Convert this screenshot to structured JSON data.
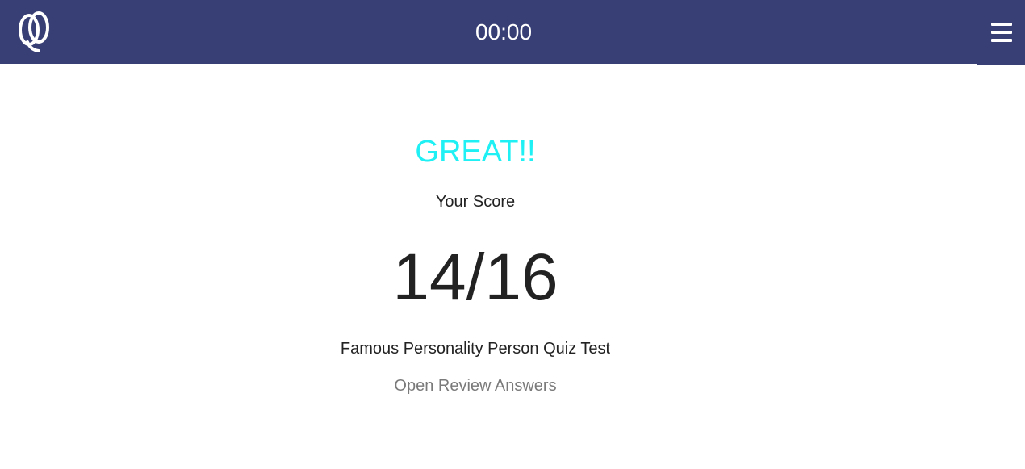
{
  "header": {
    "logo_icon": "quiz-logo-icon",
    "timer": "00:00",
    "menu_icon": "hamburger-menu-icon",
    "background_color": "#383f75"
  },
  "result": {
    "verdict": "GREAT!!",
    "verdict_color": "#1ff0f4",
    "score_label": "Your Score",
    "score": "14/16",
    "quiz_title": "Famous Personality Person Quiz Test",
    "review_link": "Open Review Answers"
  }
}
